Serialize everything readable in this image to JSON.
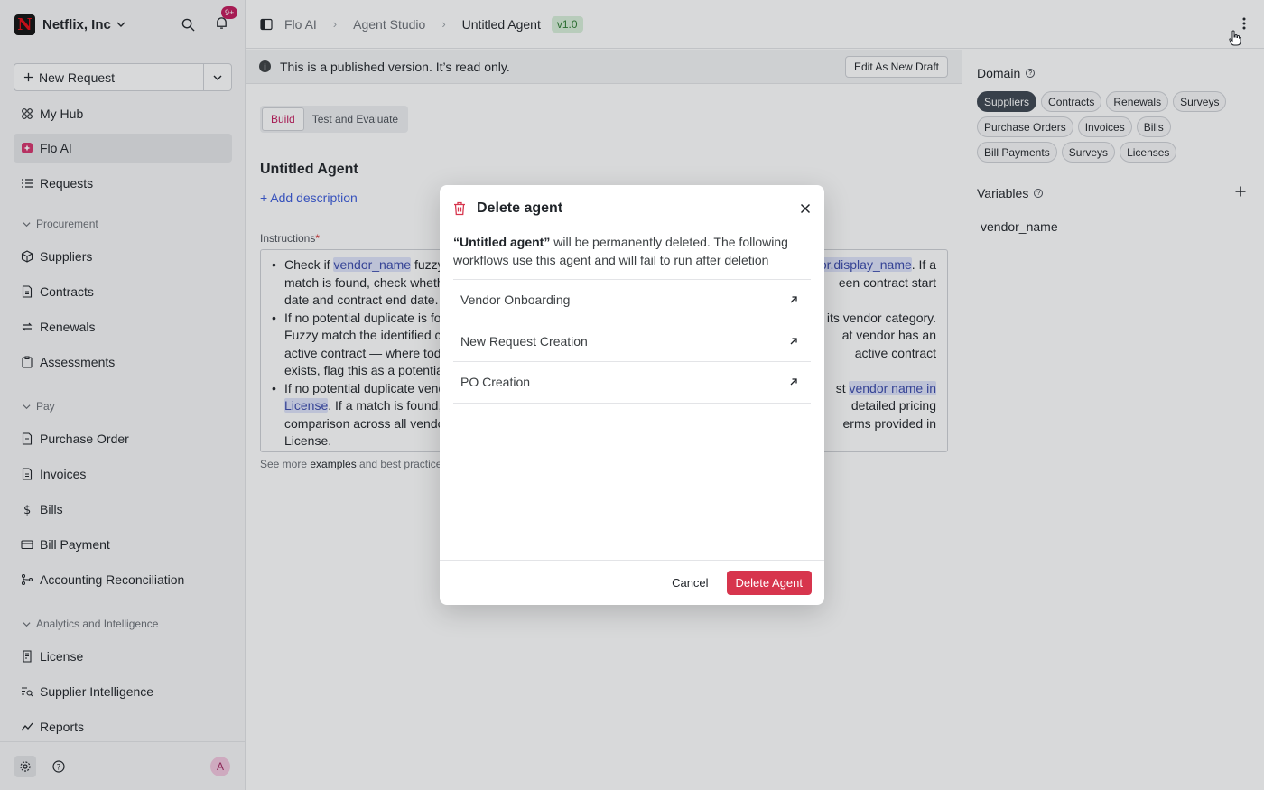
{
  "org": {
    "name": "Netflix, Inc",
    "logo_letter": "N",
    "notification_count": "9+"
  },
  "sidebar": {
    "new_request_label": "New Request",
    "items": [
      {
        "label": "My Hub",
        "icon": "hub-icon"
      },
      {
        "label": "Flo AI",
        "icon": "flo-ai-icon",
        "active": true
      },
      {
        "label": "Requests",
        "icon": "list-icon"
      }
    ],
    "procurement": {
      "title": "Procurement",
      "items": [
        {
          "label": "Suppliers",
          "icon": "box-icon"
        },
        {
          "label": "Contracts",
          "icon": "document-icon"
        },
        {
          "label": "Renewals",
          "icon": "refresh-icon"
        },
        {
          "label": "Assessments",
          "icon": "clipboard-icon"
        }
      ]
    },
    "pay": {
      "title": "Pay",
      "items": [
        {
          "label": "Purchase Order",
          "icon": "document-icon"
        },
        {
          "label": "Invoices",
          "icon": "document-icon"
        },
        {
          "label": "Bills",
          "icon": "dollar-icon"
        },
        {
          "label": "Bill Payment",
          "icon": "card-icon"
        },
        {
          "label": "Accounting Reconciliation",
          "icon": "branch-icon"
        }
      ]
    },
    "analytics": {
      "title": "Analytics and Intelligence",
      "items": [
        {
          "label": "License",
          "icon": "license-icon"
        },
        {
          "label": "Supplier Intelligence",
          "icon": "search-list-icon"
        },
        {
          "label": "Reports",
          "icon": "trend-icon"
        }
      ]
    },
    "avatar_initial": "A"
  },
  "header": {
    "breadcrumb": [
      "Flo AI",
      "Agent Studio",
      "Untitled Agent"
    ],
    "version": "v1.0"
  },
  "banner": {
    "text": "This is a published version. It’s read only.",
    "button": "Edit As New Draft"
  },
  "tabs": [
    "Build",
    "Test and Evaluate"
  ],
  "agent": {
    "title": "Untitled Agent",
    "add_description": "+ Add description",
    "instructions_label": "Instructions",
    "required_mark": "*",
    "lines": {
      "l1a": "Check if ",
      "l1b": "vendor_name",
      "l1c": " fuzzy",
      "l1d": "or.display_name",
      "l1e": ". If a",
      "l2a": "match is found, check wheth",
      "l2b": "een contract start",
      "l3a": "date and contract end date.",
      "l4a": "If no potential duplicate is fo",
      "l4b": "its vendor category.",
      "l5a": "Fuzzy match the identified c",
      "l5b": "at vendor has an",
      "l6a": "active contract — where toda",
      "l6b": "active contract",
      "l7a": "exists, flag this as a potentia",
      "l8a": "If no potential duplicate vend",
      "l8b": "st ",
      "l8c": "vendor name in",
      "l9a": "License",
      "l9b": ". If a match is found,",
      "l9c": "detailed pricing",
      "l10a": "comparison across all vendo",
      "l10b": "erms provided in",
      "l11a": "License."
    },
    "see_more_prefix": "See more ",
    "see_more_link": "examples",
    "see_more_suffix": " and best practice"
  },
  "right_panel": {
    "domain_title": "Domain",
    "domains": [
      {
        "label": "Suppliers",
        "selected": true
      },
      {
        "label": "Contracts"
      },
      {
        "label": "Renewals"
      },
      {
        "label": "Surveys"
      },
      {
        "label": "Purchase Orders"
      },
      {
        "label": "Invoices"
      },
      {
        "label": "Bills"
      },
      {
        "label": "Bill Payments"
      },
      {
        "label": "Surveys"
      },
      {
        "label": "Licenses"
      }
    ],
    "variables_title": "Variables",
    "variables": [
      "vendor_name"
    ]
  },
  "modal": {
    "title": "Delete agent",
    "desc_strong": "“Untitled agent”",
    "desc_rest": " will be permanently deleted. The following workflows use this agent and will fail to run after deletion",
    "workflows": [
      "Vendor Onboarding",
      "New Request Creation",
      "PO Creation"
    ],
    "cancel": "Cancel",
    "confirm": "Delete Agent"
  },
  "colors": {
    "accent": "#c2185b",
    "danger": "#d7354d",
    "link": "#3b5bdb",
    "version_bg": "#d8efd9"
  }
}
